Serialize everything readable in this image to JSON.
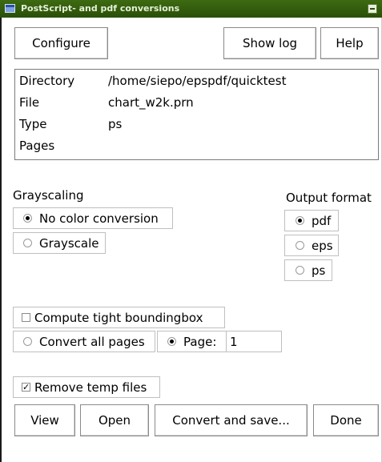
{
  "window": {
    "title": "PostScript- and pdf conversions"
  },
  "toolbar": {
    "configure_label": "Configure",
    "showlog_label": "Show log",
    "help_label": "Help"
  },
  "info": {
    "directory_label": "Directory",
    "directory_value": "/home/siepo/epspdf/quicktest",
    "file_label": "File",
    "file_value": "chart_w2k.prn",
    "type_label": "Type",
    "type_value": "ps",
    "pages_label": "Pages",
    "pages_value": ""
  },
  "grayscaling": {
    "label": "Grayscaling",
    "options": [
      {
        "label": "No color conversion",
        "selected": true
      },
      {
        "label": "Grayscale",
        "selected": false
      }
    ]
  },
  "output_format": {
    "label": "Output format",
    "options": [
      {
        "label": "pdf",
        "selected": true
      },
      {
        "label": "eps",
        "selected": false
      },
      {
        "label": "ps",
        "selected": false
      }
    ]
  },
  "bbox": {
    "label": "Compute tight boundingbox",
    "checked": false
  },
  "pages": {
    "all_label": "Convert all pages",
    "all_selected": false,
    "page_label": "Page:",
    "page_selected": true,
    "page_value": "1"
  },
  "tempfiles": {
    "label": "Remove temp files",
    "checked": true
  },
  "actions": {
    "view_label": "View",
    "open_label": "Open",
    "convert_label": "Convert and save...",
    "done_label": "Done"
  },
  "colors": {
    "titlebar": "#2a4f08",
    "titlebar_text": "#e6f0d8"
  }
}
